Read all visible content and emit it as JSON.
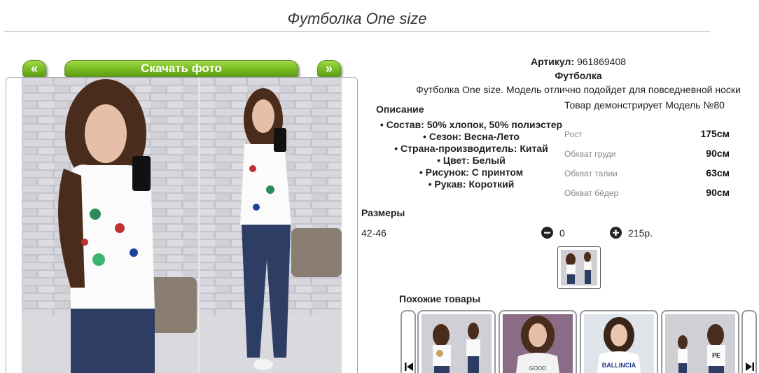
{
  "product": {
    "title": "Футболка One size",
    "article_label": "Артикул:",
    "article_value": "961869408",
    "type": "Футболка",
    "short_desc": "Футболка One size. Модель отлично подойдет для повседневной носки"
  },
  "gallery": {
    "prev_label": "«",
    "download_label": "Скачать фото",
    "next_label": "»"
  },
  "description": {
    "heading": "Описание",
    "items": [
      "Состав: 50% хлопок, 50% полиэстер",
      "Сезон: Весна-Лето",
      "Страна-производитель: Китай",
      "Цвет: Белый",
      "Рисунок: С принтом",
      "Рукав: Короткий"
    ]
  },
  "model": {
    "title": "Товар демонстрирует Модель №80",
    "measurements": [
      {
        "label": "Рост",
        "value": "175см"
      },
      {
        "label": "Обхват груди",
        "value": "90см"
      },
      {
        "label": "Обхват талии",
        "value": "63см"
      },
      {
        "label": "Обхват бёдер",
        "value": "90см"
      }
    ]
  },
  "sizes": {
    "heading": "Размеры",
    "rows": [
      {
        "size": "42-46",
        "minus_icon": "minus-circle-icon",
        "qty": "0",
        "plus_icon": "plus-circle-icon",
        "price": "215р."
      }
    ]
  },
  "similar": {
    "heading": "Похожие товары",
    "prev_icon": "skip-back-icon",
    "next_icon": "skip-forward-icon",
    "printed_text": [
      "GOOD",
      "BALLINCIA",
      "PE"
    ]
  },
  "colors": {
    "accent_green": "#7cbf24",
    "brick": "#c9c9cf",
    "jeans": "#2d3d63",
    "hair": "#4a2c1c"
  }
}
